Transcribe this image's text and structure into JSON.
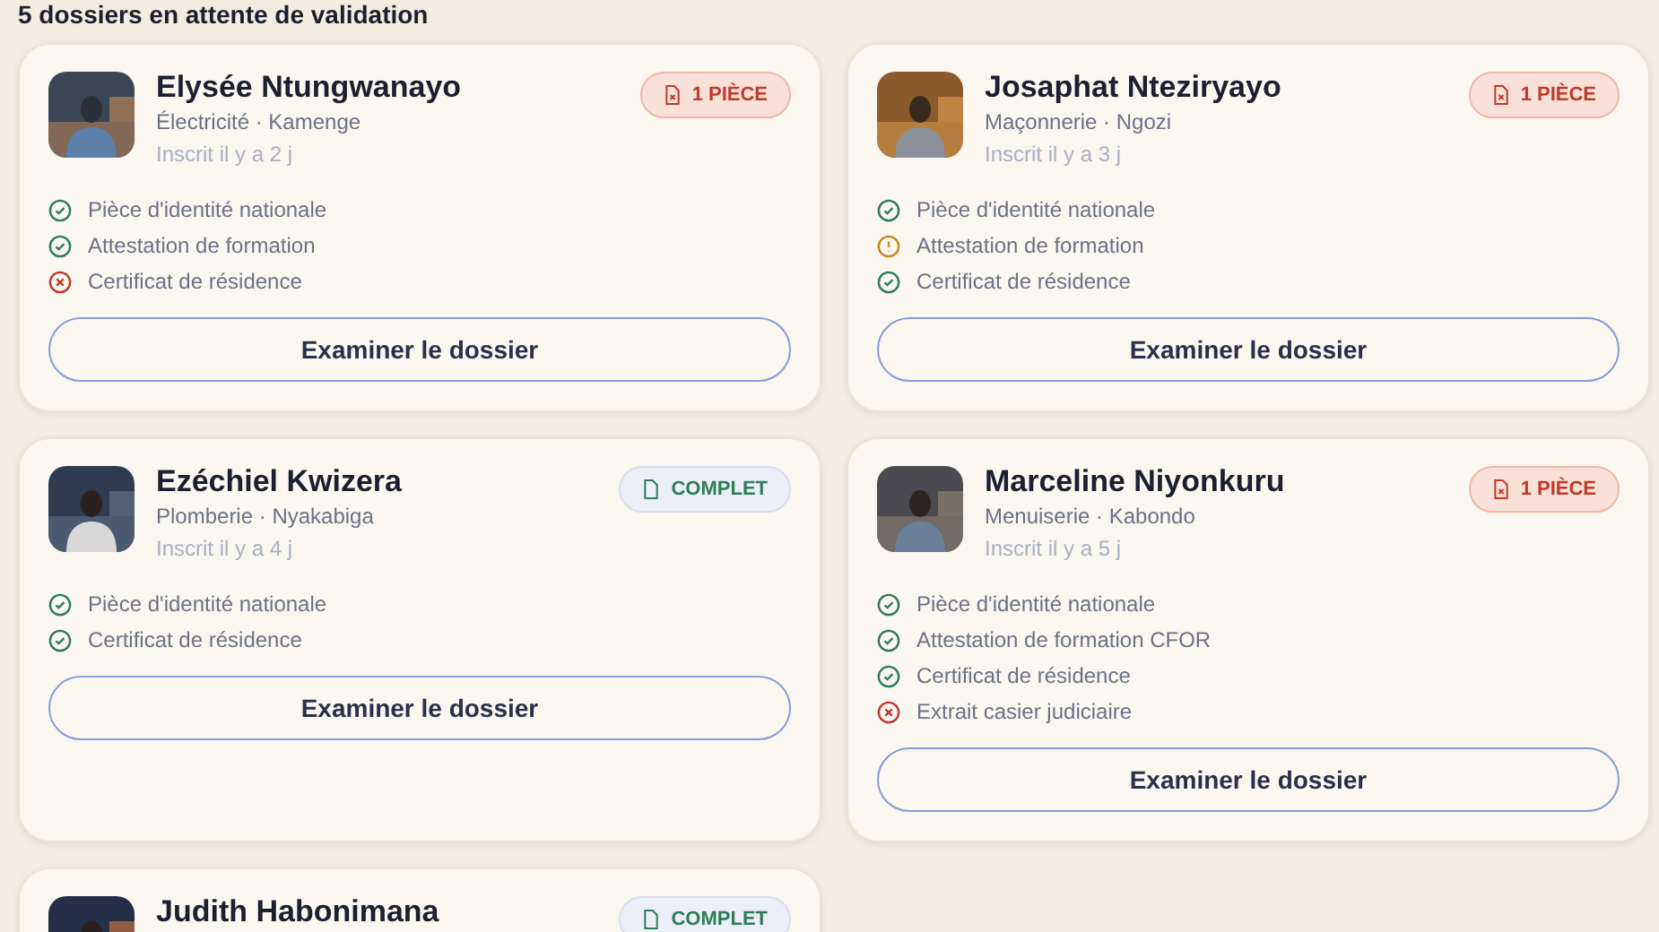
{
  "heading": "5 dossiers en attente de validation",
  "dossiers": [
    {
      "name": "Elysée Ntungwanayo",
      "trade": "Électricité · Kamenge",
      "registered": "Inscrit il y a 2 j",
      "badge": {
        "kind": "missing",
        "label": "1 PIÈCE"
      },
      "documents": [
        {
          "label": "Pièce d'identité nationale",
          "kind": "ok"
        },
        {
          "label": "Attestation de formation",
          "kind": "ok"
        },
        {
          "label": "Certificat de résidence",
          "kind": "missing"
        }
      ],
      "action": "Examiner le dossier"
    },
    {
      "name": "Josaphat Nteziryayo",
      "trade": "Maçonnerie · Ngozi",
      "registered": "Inscrit il y a 3 j",
      "badge": {
        "kind": "missing",
        "label": "1 PIÈCE"
      },
      "documents": [
        {
          "label": "Pièce d'identité nationale",
          "kind": "ok"
        },
        {
          "label": "Attestation de formation",
          "kind": "warning"
        },
        {
          "label": "Certificat de résidence",
          "kind": "ok"
        }
      ],
      "action": "Examiner le dossier"
    },
    {
      "name": "Ezéchiel Kwizera",
      "trade": "Plomberie · Nyakabiga",
      "registered": "Inscrit il y a 4 j",
      "badge": {
        "kind": "complete",
        "label": "COMPLET"
      },
      "documents": [
        {
          "label": "Pièce d'identité nationale",
          "kind": "ok"
        },
        {
          "label": "Certificat de résidence",
          "kind": "ok"
        }
      ],
      "action": "Examiner le dossier"
    },
    {
      "name": "Marceline Niyonkuru",
      "trade": "Menuiserie · Kabondo",
      "registered": "Inscrit il y a 5 j",
      "badge": {
        "kind": "missing",
        "label": "1 PIÈCE"
      },
      "documents": [
        {
          "label": "Pièce d'identité nationale",
          "kind": "ok"
        },
        {
          "label": "Attestation de formation CFOR",
          "kind": "ok"
        },
        {
          "label": "Certificat de résidence",
          "kind": "ok"
        },
        {
          "label": "Extrait casier judiciaire",
          "kind": "missing"
        }
      ],
      "action": "Examiner le dossier"
    },
    {
      "name": "Judith Habonimana",
      "badge": {
        "kind": "complete",
        "label": "COMPLET"
      }
    }
  ]
}
